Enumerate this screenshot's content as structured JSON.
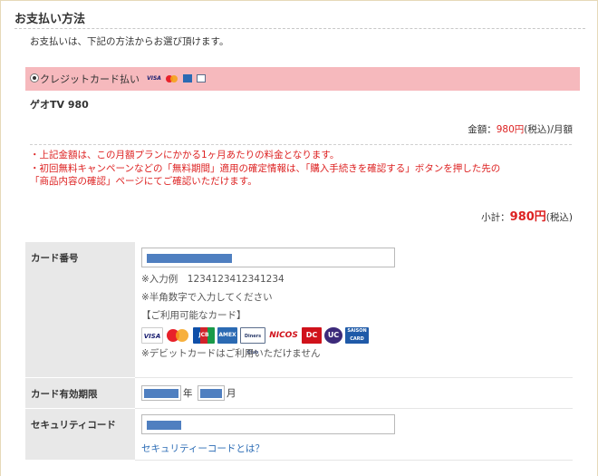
{
  "page": {
    "title": "お支払い方法",
    "intro": "お支払いは、下記の方法からお選び頂けます。"
  },
  "payment_method": {
    "option_label": "クレジットカード払い",
    "selected": true,
    "brand_icons": [
      "visa-icon",
      "mastercard-icon",
      "amex-icon",
      "diners-icon"
    ]
  },
  "product": {
    "name": "ゲオTV 980",
    "price_prefix": "金額：",
    "price": "980円",
    "price_suffix": "(税込)/月額"
  },
  "notes": [
    "・上記金額は、この月額プランにかかる1ヶ月あたりの料金となります。",
    "・初回無料キャンペーンなどの「無料期間」適用の確定情報は、「購入手続きを確認する」ボタンを押した先の",
    "「商品内容の確認」ページにてご確認いただけます。"
  ],
  "subtotal": {
    "prefix": "小計：",
    "amount": "980円",
    "suffix": "(税込)"
  },
  "card_form": {
    "card_number": {
      "label": "カード番号",
      "example": "※入力例　1234123412341234",
      "halfwidth_note": "※半角数字で入力してください",
      "available_heading": "【ご利用可能なカード】",
      "brands": [
        "VISA",
        "MasterCard",
        "JCB",
        "AMEX",
        "Diners Club",
        "NICOS",
        "DC",
        "UC",
        "SAISON CARD"
      ],
      "debit_note": "※デビットカードはご利用いただけません"
    },
    "expiry": {
      "label": "カード有効期限",
      "year_unit": "年",
      "month_unit": "月"
    },
    "security_code": {
      "label": "セキュリティコード",
      "help_link": "セキュリティーコードとは？"
    }
  },
  "colors": {
    "accent_red": "#dd2222",
    "band_pink": "#f6b9bd",
    "label_gray": "#e8e8e8",
    "link_blue": "#2b6cb5",
    "masked_fill": "#4f7fc0"
  }
}
